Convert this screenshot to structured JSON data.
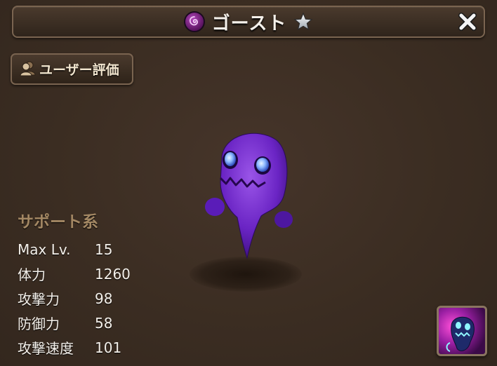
{
  "window": {
    "title": "ゴースト",
    "attribute_icon": "dark-attribute-icon",
    "close_icon": "close-x-icon",
    "star_icon": "star-icon"
  },
  "review_button": {
    "label": "ユーザー評価",
    "icon": "users-icon"
  },
  "monster": {
    "type_label": "サポート系",
    "stats": [
      {
        "label": "Max Lv.",
        "value": "15"
      },
      {
        "label": "体力",
        "value": "1260"
      },
      {
        "label": "攻撃力",
        "value": "98"
      },
      {
        "label": "防御力",
        "value": "58"
      },
      {
        "label": "攻撃速度",
        "value": "101"
      }
    ]
  },
  "skill": {
    "icon": "ghost-skill-icon"
  },
  "colors": {
    "background": "#3a2c21",
    "frame": "#7a6450",
    "type_label": "#a38763",
    "text": "#f4f0ea",
    "ghost_purple": "#7a2fd0"
  }
}
